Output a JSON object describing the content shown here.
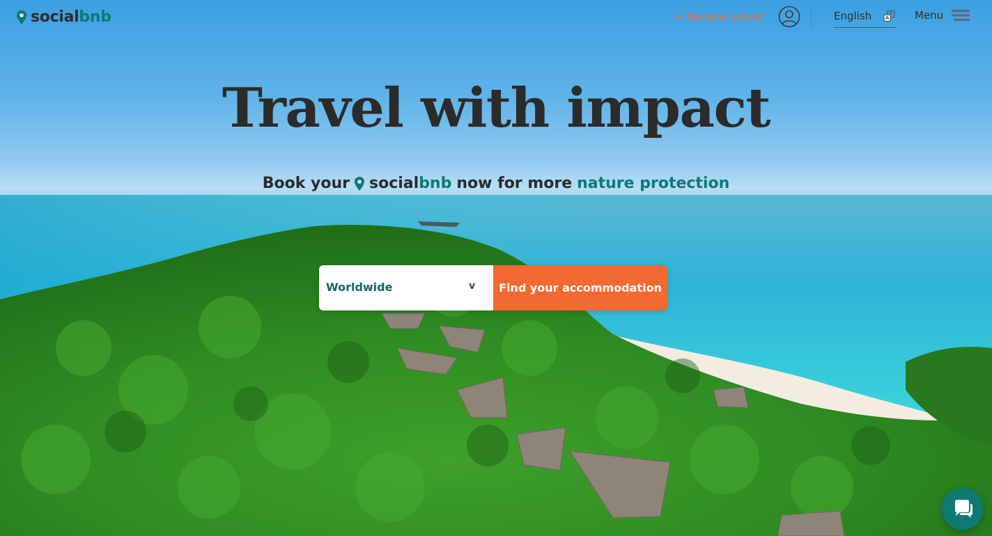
{
  "header": {
    "logo": {
      "part1": "social",
      "part2": "bnb"
    },
    "become_host": "+ Become a host",
    "language": "English",
    "menu_label": "Menu"
  },
  "hero": {
    "headline": "Travel with impact",
    "sub_prefix": "Book your",
    "sub_brand1": "social",
    "sub_brand2": "bnb",
    "sub_mid": "now for more",
    "sub_highlight": "nature protection"
  },
  "search": {
    "selected_destination": "Worldwide",
    "chevron": "v",
    "button_label": "Find your accommodation"
  },
  "colors": {
    "brand_teal": "#0d7a72",
    "accent_orange": "#f26a31",
    "text_dark": "#2b2b2b"
  },
  "icons": [
    "location-pin-icon",
    "user-account-icon",
    "translate-icon",
    "hamburger-menu-icon",
    "chevron-down-icon",
    "chat-bubble-icon"
  ]
}
